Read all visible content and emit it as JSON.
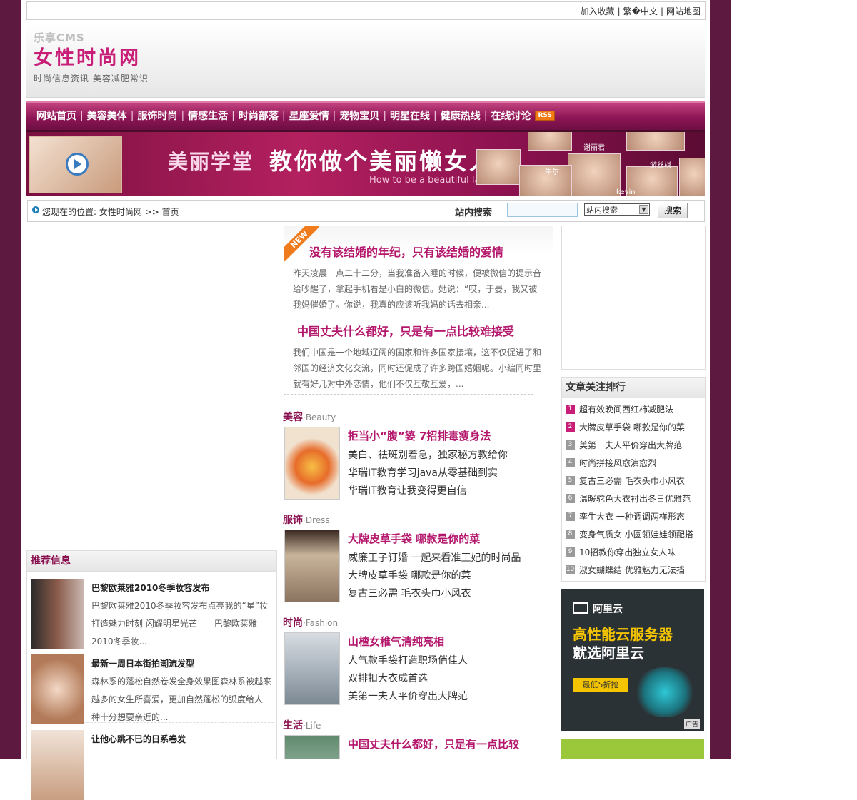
{
  "toplinks": [
    "加入收藏",
    "繁�中文",
    "网站地图"
  ],
  "logo": {
    "cms": "乐享CMS",
    "main": "女性时尚网",
    "sub": "时尚信息资讯 美容减肥常识"
  },
  "nav": [
    "网站首页",
    "美容美体",
    "服饰时尚",
    "情感生活",
    "时尚部落",
    "星座爱情",
    "宠物宝贝",
    "明星在线",
    "健康热线",
    "在线讨论"
  ],
  "rss": "RSS",
  "banner": {
    "label": "美丽学堂",
    "title": "教你做个美丽懒女人",
    "en": "How to be a beautiful lady",
    "names": [
      "谢丽君",
      "游丝棋",
      "牛尔",
      "kevin"
    ]
  },
  "crumb": {
    "prefix": "您现在的位置:",
    "site": "女性时尚网",
    "arrow": ">>",
    "current": "首页"
  },
  "search": {
    "label": "站内搜索",
    "select_value": "站内搜索",
    "button": "搜索"
  },
  "feature": {
    "badge": "NEW",
    "items": [
      {
        "title": "没有该结婚的年纪，只有该结婚的爱情",
        "desc": "昨天凌晨一点二十二分，当我准备入睡的时候，便被微信的提示音给吵醒了，拿起手机看是小白的微信。她说：“哎，于晏，我又被我妈催婚了。你说，我真的应该听我妈的话去相亲..."
      },
      {
        "title": "中国丈夫什么都好，只是有一点比较难接受",
        "desc": "我们中国是一个地域辽阔的国家和许多国家接壤，这不仅促进了和邻国的经济文化交流，同时还促成了许多跨国婚姻呢。小编同时里就有好几对中外恋情，他们不仅互敬互爱，..."
      }
    ]
  },
  "categories": [
    {
      "name": "美容",
      "en": "·Beauty",
      "title": "拒当小“腹”婆 7招排毒瘦身法",
      "links": [
        "美白、祛斑别着急，独家秘方教给你",
        "华瑞IT教育学习java从零基础到实",
        "华瑞IT教育让我变得更自信"
      ]
    },
    {
      "name": "服饰",
      "en": "·Dress",
      "title": "大牌皮草手袋 哪款是你的菜",
      "links": [
        "威廉王子订婚 一起来看准王妃的时尚品",
        "大牌皮草手袋 哪款是你的菜",
        "复古三必需 毛衣头巾小风衣"
      ]
    },
    {
      "name": "时尚",
      "en": "·Fashion",
      "title": "山楂女稚气清纯亮相",
      "links": [
        "人气款手袋打造职场俏佳人",
        "双排扣大衣成首选",
        "美第一夫人平价穿出大牌范"
      ]
    },
    {
      "name": "生活",
      "en": "·Life",
      "title": "中国丈夫什么都好，只是有一点比较",
      "links": []
    }
  ],
  "recommend": {
    "title": "推荐信息",
    "items": [
      {
        "title": "巴黎欧莱雅2010冬季妆容发布",
        "desc": "巴黎欧莱雅2010冬季妆容发布点亮我的“星”妆 打造魅力时刻 闪耀明星光芒——巴黎欧莱雅2010冬季妆..."
      },
      {
        "title": "最新一周日本街拍潮流发型",
        "desc": "森林系的蓬松自然卷发全身效果图森林系被越来越多的女生所喜爱，更加自然蓬松的弧度给人一种十分想要亲近的..."
      },
      {
        "title": "让他心跳不已的日系卷发",
        "desc": ""
      }
    ]
  },
  "ranking": {
    "title": "文章关注排行",
    "items": [
      "超有效晚间西红柿减肥法",
      "大牌皮草手袋 哪款是你的菜",
      "美第一夫人平价穿出大牌范",
      "时尚拼接风愈演愈烈",
      "复古三必需 毛衣头巾小风衣",
      "温暖驼色大衣衬出冬日优雅范",
      "孪生大衣 一种调调两样形态",
      "变身气质女 小圆领娃娃领配搭",
      "10招教你穿出独立女人味",
      "淑女蝴蝶结 优雅魅力无法挡"
    ]
  },
  "aliyun": {
    "logo": "阿里云",
    "line1": "高性能云服务器",
    "line2": "就选阿里云",
    "button": "最低5折抢",
    "tag": "广告"
  },
  "colors": {
    "brand": "#c81e78",
    "nav": "#8e1556",
    "bg": "#5e1940"
  }
}
